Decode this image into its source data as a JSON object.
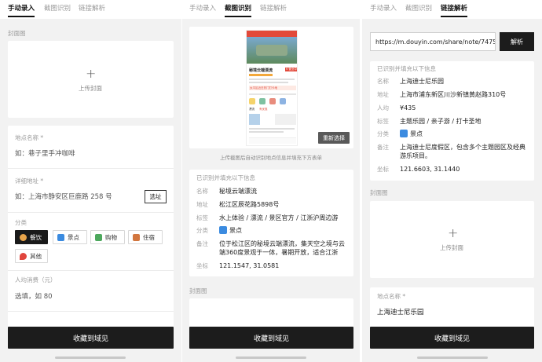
{
  "tabs": {
    "manual": "手动录入",
    "screenshot": "截图识别",
    "link": "链接解析"
  },
  "manual": {
    "cover_label": "封面图",
    "upload_plus": "+",
    "upload_text": "上传封面",
    "name_label": "地点名称 *",
    "name_placeholder": "如：巷子里手冲咖啡",
    "address_label": "详细地址 *",
    "address_placeholder": "如：上海市静安区巨鹿路 258 号",
    "pick_button": "选址",
    "category_label": "分类",
    "categories": [
      {
        "label": "餐饮",
        "selected": true,
        "icon": "bowl-icon",
        "color": "#e9a54b"
      },
      {
        "label": "景点",
        "selected": false,
        "icon": "scenic-icon",
        "color": "#3b8be0"
      },
      {
        "label": "购物",
        "selected": false,
        "icon": "shopping-icon",
        "color": "#4da85d"
      },
      {
        "label": "住宿",
        "selected": false,
        "icon": "hotel-icon",
        "color": "#d2763f"
      },
      {
        "label": "其他",
        "selected": false,
        "icon": "pin-icon",
        "color": "#e0453d"
      }
    ],
    "price_label": "人均消费（元）",
    "price_placeholder": "选填，如 80"
  },
  "screenshot": {
    "reselect_button": "重新选择",
    "caption": "上传截图后自动识别地点信息并填充下方表单",
    "mini": {
      "title": "秘境云端漂流",
      "tag": "¥ 营业中",
      "hot_tag": "太平区近日热门打卡地",
      "item1": "漂流",
      "item2": "有优惠"
    },
    "recognized_title": "已识别并填充以下信息",
    "rows": [
      {
        "label": "名称",
        "value": "秘境云端漂流"
      },
      {
        "label": "地址",
        "value": "松江区辰花路5898号"
      },
      {
        "label": "标签",
        "value": "水上体验 / 漂流 / 景区官方 / 江浙沪周边游"
      },
      {
        "label": "分类",
        "value": "景点"
      },
      {
        "label": "备注",
        "value": "位于松江区的秘境云端漂流，集天空之境与云端360度景观于一体，暑期开放，适合江浙"
      },
      {
        "label": "坐标",
        "value": "121.1547, 31.0581"
      }
    ],
    "cover_label": "封面图"
  },
  "link": {
    "url_value": "https://m.douyin.com/share/note/747592",
    "parse_button": "解析",
    "recognized_title": "已识别并填充以下信息",
    "rows": [
      {
        "label": "名称",
        "value": "上海迪士尼乐园"
      },
      {
        "label": "地址",
        "value": "上海市浦东新区川沙新镇黄赵路310号"
      },
      {
        "label": "人均",
        "value": "¥435"
      },
      {
        "label": "标签",
        "value": "主题乐园 / 亲子游 / 打卡圣地"
      },
      {
        "label": "分类",
        "value": "景点"
      },
      {
        "label": "备注",
        "value": "上海迪士尼度假区，包含多个主题园区及经典游乐项目。"
      },
      {
        "label": "坐标",
        "value": "121.6603, 31.1440"
      }
    ],
    "cover_label": "封面图",
    "upload_plus": "+",
    "upload_text": "上传封面",
    "name_label": "地点名称 *",
    "name_value": "上海迪士尼乐园"
  },
  "bottom_button": "收藏到域见",
  "colors": {
    "primary": "#1c1c1c",
    "background": "#f2f2f2",
    "scenic": "#3b8be0"
  }
}
